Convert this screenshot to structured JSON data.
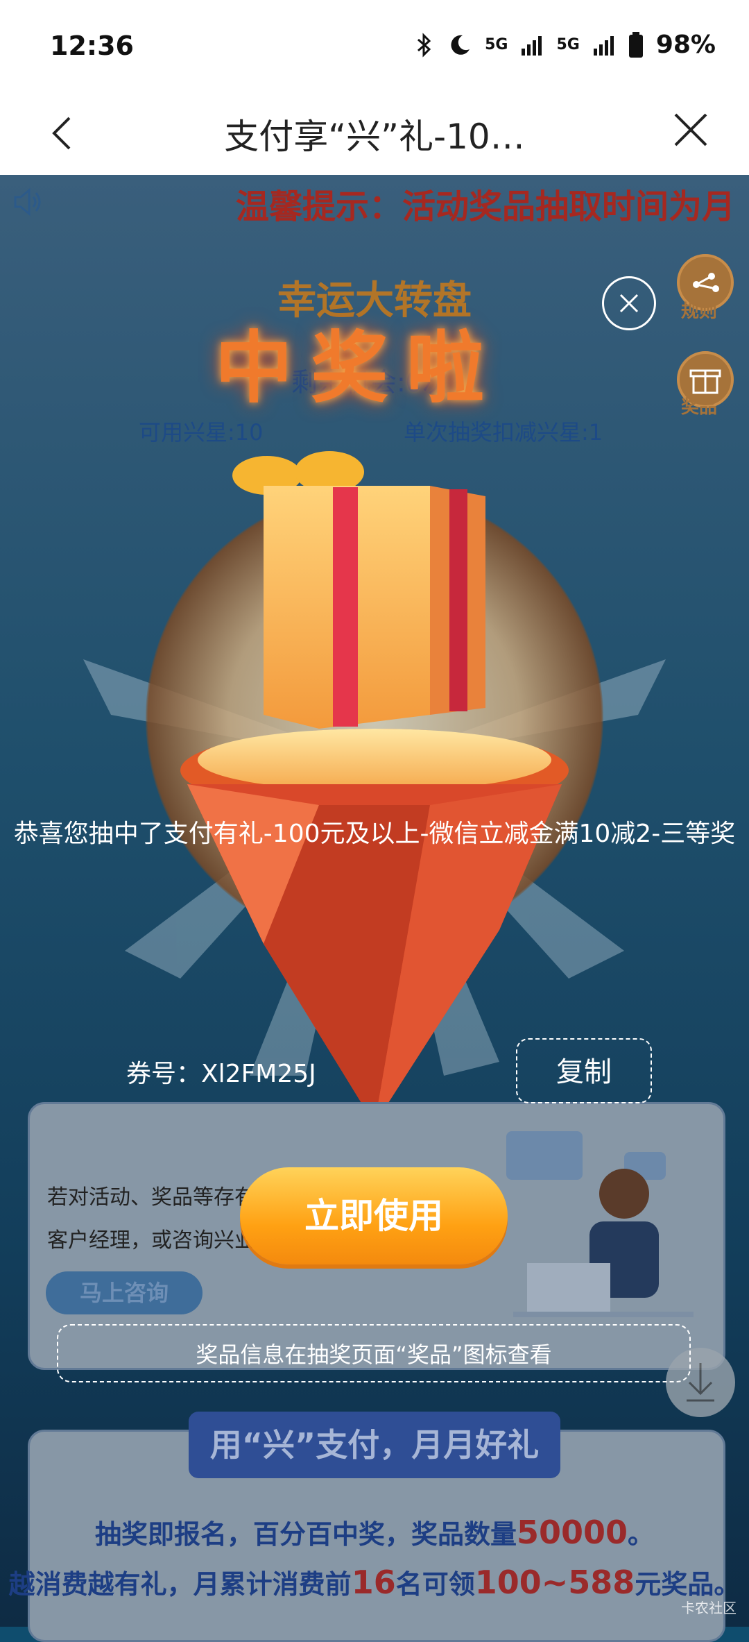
{
  "status_bar": {
    "time": "12:36",
    "signal_1": "5G",
    "signal_2": "5G",
    "battery": "98%",
    "icons": [
      "bluetooth-icon",
      "moon-icon",
      "signal-icon",
      "signal-icon",
      "battery-icon"
    ]
  },
  "nav": {
    "title": "支付享“兴”礼-10…",
    "back_icon": "chevron-left-icon",
    "close_icon": "close-icon"
  },
  "page": {
    "tip": "温馨提示：活动奖品抽取时间为月",
    "side_buttons": [
      {
        "label": "规则",
        "icon": "share-icon"
      },
      {
        "label": "奖品",
        "icon": "gift-icon"
      }
    ],
    "lucky_title": "幸运大转盘",
    "remaining": "剩余机会:0次",
    "stars_available": "可用兴星:10",
    "stars_cost": "单次抽奖扣减兴星:1",
    "card1_text_1": "若对活动、奖品等存有",
    "card1_text_2": "客户经理，或咨询兴业",
    "consult_button": "马上咨询",
    "section_banner": "用“兴”支付，月月好礼",
    "promo_line1_a": "抽奖即报名，百分百中奖，奖品数量",
    "promo_line1_b": "50000",
    "promo_line1_c": "。",
    "promo_line2_a": "越消费越有礼，月累计消费前",
    "promo_line2_b": "16",
    "promo_line2_c": "名可领",
    "promo_line2_d": "100~588",
    "promo_line2_e": "元奖品。",
    "watermark": "卡农社区"
  },
  "modal": {
    "heading": "中奖啦",
    "prize_text": "恭喜您抽中了支付有礼-100元及以上-微信立减金满10减2-三等奖",
    "code_label": "券号：",
    "code_value": "Xl2FM25J",
    "copy_button": "复制",
    "use_button": "立即使用",
    "note": "奖品信息在抽奖页面“奖品”图标查看"
  },
  "colors": {
    "accent_orange": "#ffa113",
    "tip_red": "#a62820",
    "heading_orange": "#f07a2c"
  }
}
